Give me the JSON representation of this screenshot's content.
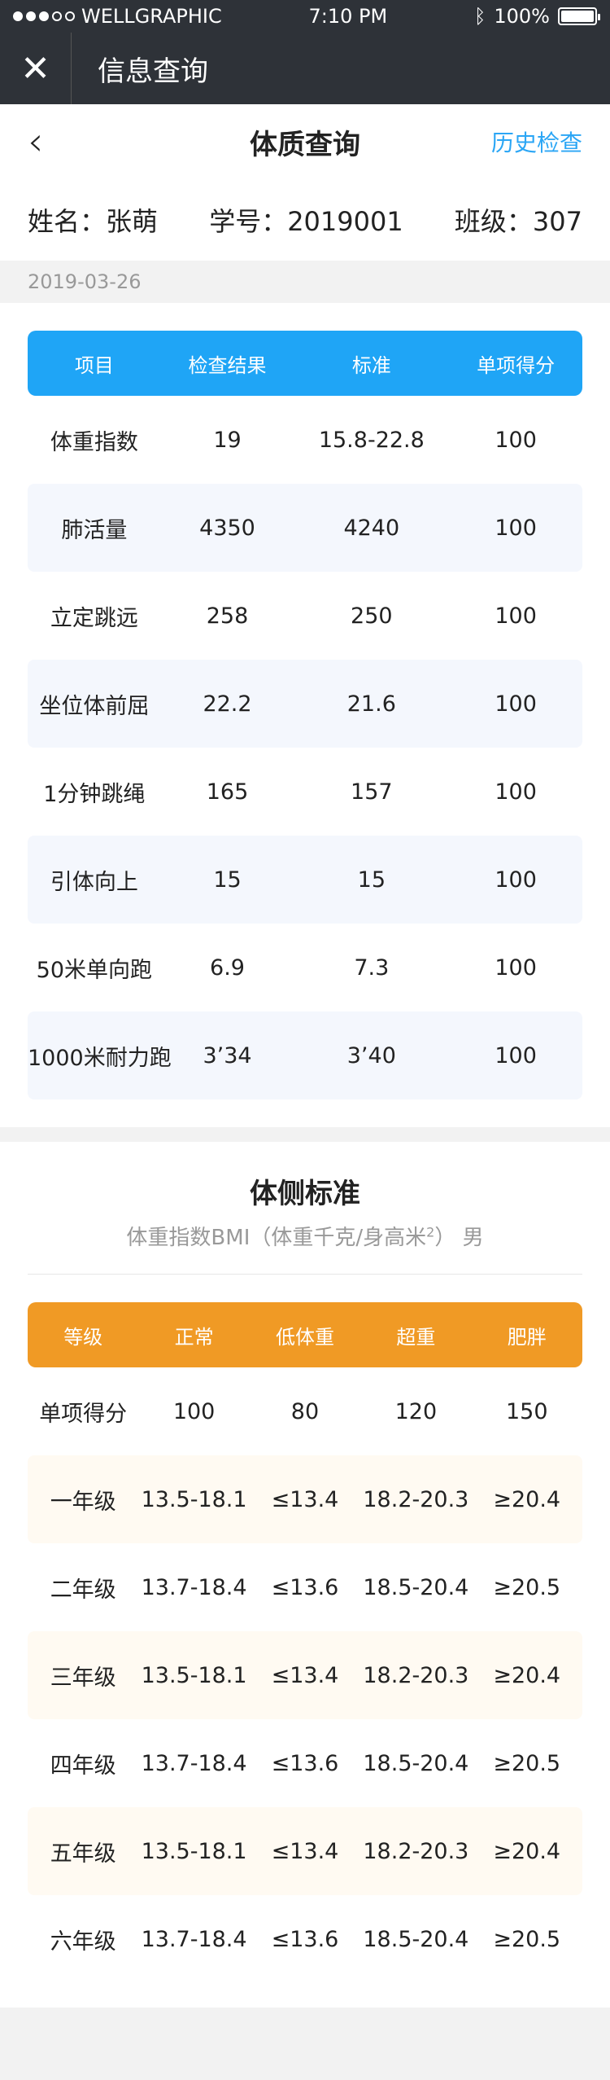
{
  "status": {
    "carrier": "WELLGRAPHIC",
    "time": "7:10 PM",
    "battery": "100%",
    "battery_level": 1.0
  },
  "wx": {
    "title": "信息查询"
  },
  "nav": {
    "title": "体质查询",
    "history": "历史检查"
  },
  "student": {
    "name": "姓名：张萌",
    "id": "学号：2019001",
    "class": "班级：307"
  },
  "date": "2019-03-26",
  "results": {
    "headers": [
      "项目",
      "检查结果",
      "标准",
      "单项得分"
    ],
    "rows": [
      [
        "体重指数",
        "19",
        "15.8-22.8",
        "100"
      ],
      [
        "肺活量",
        "4350",
        "4240",
        "100"
      ],
      [
        "立定跳远",
        "258",
        "250",
        "100"
      ],
      [
        "坐位体前屈",
        "22.2",
        "21.6",
        "100"
      ],
      [
        "1分钟跳绳",
        "165",
        "157",
        "100"
      ],
      [
        "引体向上",
        "15",
        "15",
        "100"
      ],
      [
        "50米单向跑",
        "6.9",
        "7.3",
        "100"
      ],
      [
        "1000米耐力跑",
        "3’34",
        "3’40",
        "100"
      ]
    ]
  },
  "standard": {
    "title": "体侧标准",
    "subtitle_a": "体重指数BMI（体重千克/身高米",
    "subtitle_sup": "2",
    "subtitle_b": "）  男",
    "headers": [
      "等级",
      "正常",
      "低体重",
      "超重",
      "肥胖"
    ],
    "rows": [
      [
        "单项得分",
        "100",
        "80",
        "120",
        "150"
      ],
      [
        "一年级",
        "13.5-18.1",
        "≤13.4",
        "18.2-20.3",
        "≥20.4"
      ],
      [
        "二年级",
        "13.7-18.4",
        "≤13.6",
        "18.5-20.4",
        "≥20.5"
      ],
      [
        "三年级",
        "13.5-18.1",
        "≤13.4",
        "18.2-20.3",
        "≥20.4"
      ],
      [
        "四年级",
        "13.7-18.4",
        "≤13.6",
        "18.5-20.4",
        "≥20.5"
      ],
      [
        "五年级",
        "13.5-18.1",
        "≤13.4",
        "18.2-20.3",
        "≥20.4"
      ],
      [
        "六年级",
        "13.7-18.4",
        "≤13.6",
        "18.5-20.4",
        "≥20.5"
      ]
    ]
  }
}
